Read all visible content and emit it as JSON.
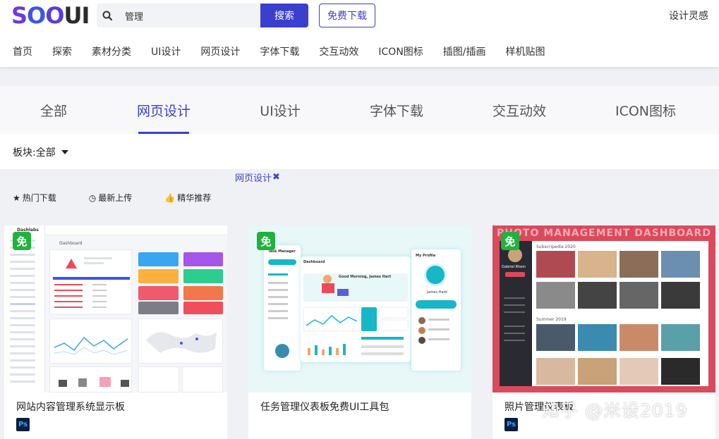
{
  "brand": {
    "logo_s": "S",
    "logo_o1": "O",
    "logo_o2": "O",
    "logo_ui": "UI",
    "accent": "#3b3fce"
  },
  "search": {
    "value": "管理",
    "button": "搜索",
    "icon": "search-icon"
  },
  "header": {
    "free_download": "免费下载",
    "inspiration": "设计灵感"
  },
  "nav": [
    "首页",
    "探索",
    "素材分类",
    "UI设计",
    "网页设计",
    "字体下载",
    "交互动效",
    "ICON图标",
    "插图/插画",
    "样机贴图"
  ],
  "categories": [
    "全部",
    "网页设计",
    "UI设计",
    "字体下载",
    "交互动效",
    "ICON图标"
  ],
  "filter": {
    "label": "板块:",
    "value": "全部"
  },
  "active_tag": {
    "label": "网页设计",
    "remove": "✖"
  },
  "sort": [
    {
      "icon": "★",
      "label": "热门下载"
    },
    {
      "icon": "◷",
      "label": "最新上传"
    },
    {
      "icon": "👍",
      "label": "精华推荐"
    }
  ],
  "cards": [
    {
      "badge": "免",
      "title": "网站内容管理系统显示板",
      "format": "Ps",
      "thumb": {
        "brand": "Dashlabs",
        "section": "Dashboard"
      }
    },
    {
      "badge": "免",
      "title": "任务管理仪表板免费UI工具包",
      "format": "Ps",
      "thumb": {
        "app": "Task Manager",
        "panel": "Dashboard",
        "greeting": "Good Morning, James Hart",
        "profile": "My Profile",
        "name": "James Hard"
      }
    },
    {
      "badge": "免",
      "title": "照片管理仪表板",
      "format": "Ps",
      "thumb": {
        "header": "PHOTO MANAGEMENT DASHBOARD",
        "user": "Gabriel Rhein",
        "album1": "Subscripedia 2020",
        "album2": "Summer 2019"
      }
    }
  ],
  "watermark": "知乎 @米设2019"
}
